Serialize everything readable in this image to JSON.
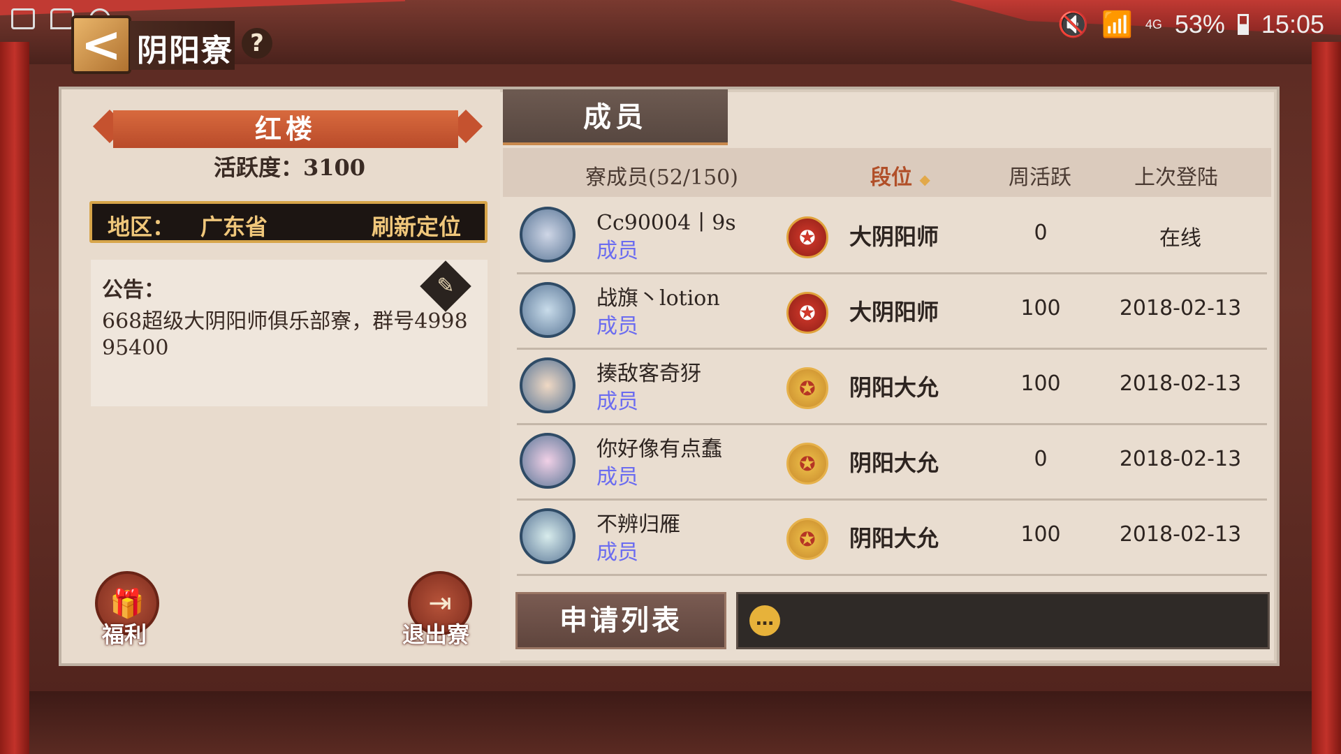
{
  "status_bar": {
    "battery": "53%",
    "time": "15:05",
    "network": "4G"
  },
  "header": {
    "title": "阴阳寮",
    "back_icon": "chevron-left-icon",
    "help": "?"
  },
  "guild": {
    "name": "红楼",
    "activity": "活跃度：3100",
    "region_label": "地区：",
    "region_value": "广东省",
    "refresh_label": "刷新定位",
    "notice_title": "公告：",
    "notice_text": "668超级大阴阳师俱乐部寮，群号499895400"
  },
  "left_buttons": {
    "welfare": "福利",
    "quit": "退出寮"
  },
  "tabs": {
    "members": "成员"
  },
  "table": {
    "headers": {
      "members": "寮成员(52/150)",
      "rank": "段位",
      "weekly": "周活跃",
      "last_login": "上次登陆"
    },
    "rows": [
      {
        "name": "Cc90004丨9s",
        "role": "成员",
        "rank_tier": "red",
        "rank": "大阴阳师",
        "weekly": "0",
        "last_login": "在线"
      },
      {
        "name": "战旗丶lotion",
        "role": "成员",
        "rank_tier": "red",
        "rank": "大阴阳师",
        "weekly": "100",
        "last_login": "2018-02-13"
      },
      {
        "name": "揍敌客奇犽",
        "role": "成员",
        "rank_tier": "gold",
        "rank": "阴阳大允",
        "weekly": "100",
        "last_login": "2018-02-13"
      },
      {
        "name": "你好像有点蠢",
        "role": "成员",
        "rank_tier": "gold",
        "rank": "阴阳大允",
        "weekly": "0",
        "last_login": "2018-02-13"
      },
      {
        "name": "不辨归雁",
        "role": "成员",
        "rank_tier": "gold",
        "rank": "阴阳大允",
        "weekly": "100",
        "last_login": "2018-02-13"
      }
    ]
  },
  "bottom": {
    "apply_list": "申请列表"
  },
  "colors": {
    "banner": "#c5522f",
    "role_text": "#6b6cf0",
    "rank_header": "#b14f28"
  }
}
